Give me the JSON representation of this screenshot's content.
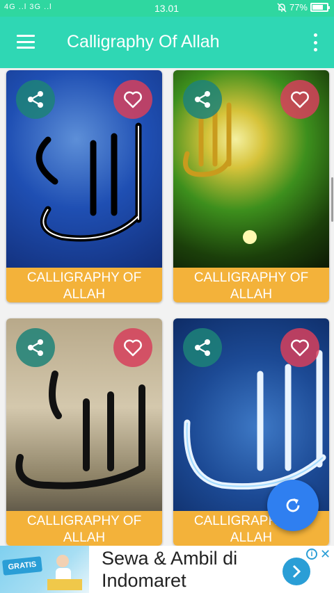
{
  "status_bar": {
    "signal": "4G ..l 3G ..l",
    "time": "13.01",
    "battery": "77%",
    "battery_level": 0.77
  },
  "app_bar": {
    "title": "Calligraphy Of Allah",
    "menu_icon": "hamburger-icon",
    "overflow_icon": "more-vert-icon"
  },
  "cards": [
    {
      "label": "CALLIGRAPHY OF ALLAH",
      "share_icon": "share-icon",
      "favorite_icon": "heart-icon",
      "image": "allah-calligraphy-blue-clouds"
    },
    {
      "label": "CALLIGRAPHY OF ALLAH",
      "share_icon": "share-icon",
      "favorite_icon": "heart-icon",
      "image": "allah-calligraphy-green-gold"
    },
    {
      "label": "CALLIGRAPHY OF ALLAH",
      "share_icon": "share-icon",
      "favorite_icon": "heart-icon",
      "image": "allah-calligraphy-beige-stone"
    },
    {
      "label": "CALLIGRAPHY OF ALLAH",
      "share_icon": "share-icon",
      "favorite_icon": "heart-icon",
      "image": "allah-calligraphy-blue-glow"
    }
  ],
  "fab": {
    "icon": "refresh-icon"
  },
  "ad": {
    "badge": "GRATIS",
    "text": "Sewa & Ambil di Indomaret",
    "info_icon": "info-icon",
    "close_icon": "close-icon",
    "go_icon": "chevron-right-icon"
  },
  "colors": {
    "status_bar": "#2fd7a0",
    "app_bar": "#2fd7b4",
    "card_label": "#f3b23a",
    "share_button": "#1d8278",
    "heart_button": "#d6405c",
    "fab": "#2f7ff0",
    "ad_accent": "#2a9ed6"
  }
}
